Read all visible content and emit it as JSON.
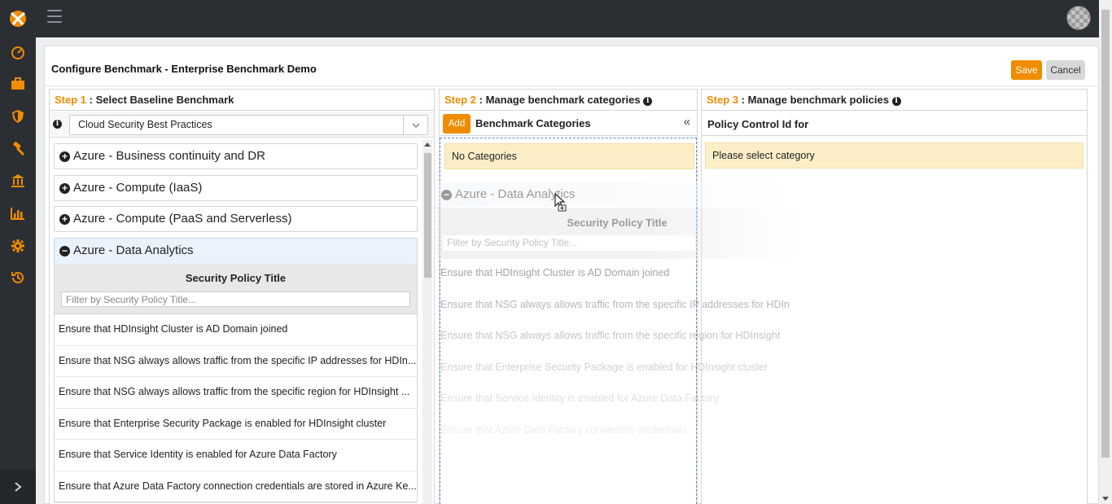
{
  "header": {
    "menu_icon": "hamburger-icon",
    "avatar_icon": "user-avatar"
  },
  "sidebar": {
    "items": [
      {
        "icon": "dashboard-gauge-icon"
      },
      {
        "icon": "briefcase-icon"
      },
      {
        "icon": "shield-icon"
      },
      {
        "icon": "hammer-icon"
      },
      {
        "icon": "bank-icon"
      },
      {
        "icon": "bar-chart-icon"
      },
      {
        "icon": "gear-icon"
      },
      {
        "icon": "history-icon"
      }
    ],
    "expand_icon": "chevron-right-icon"
  },
  "page": {
    "title": "Configure Benchmark - Enterprise Benchmark Demo",
    "save_label": "Save",
    "cancel_label": "Cancel"
  },
  "step1": {
    "step_label": "Step 1",
    "title": " : Select Baseline Benchmark",
    "selected_benchmark": "Cloud Security Best Practices",
    "categories": [
      {
        "label": "Azure - Business continuity and DR",
        "expanded": false
      },
      {
        "label": "Azure - Compute (IaaS)",
        "expanded": false
      },
      {
        "label": "Azure - Compute (PaaS and Serverless)",
        "expanded": false
      },
      {
        "label": "Azure - Data Analytics",
        "expanded": true
      }
    ],
    "policy_table": {
      "header": "Security Policy Title",
      "filter_placeholder": "Filter by Security Policy Title...",
      "rows": [
        "Ensure that HDInsight Cluster is AD Domain joined",
        "Ensure that NSG always allows traffic from the specific IP addresses for HDIn...",
        "Ensure that NSG always allows traffic from the specific region for HDInsight ...",
        "Ensure that Enterprise Security Package is enabled for HDInsight cluster",
        "Ensure that Service Identity is enabled for Azure Data Factory",
        "Ensure that Azure Data Factory connection credentials are stored in Azure Ke..."
      ]
    }
  },
  "step2": {
    "step_label": "Step 2",
    "title": " : Manage benchmark categories ",
    "add_label": "Add",
    "subtitle": "Benchmark Categories",
    "collapse_glyph": "«",
    "empty_text": "No Categories",
    "drag_ghost": {
      "label": "Azure - Data Analytics",
      "header": "Security Policy Title",
      "filter_placeholder": "Filter by Security Policy Title...",
      "rows": [
        "Ensure that HDInsight Cluster is AD Domain joined",
        "Ensure that NSG always allows traffic from the specific IP addresses for HDIn",
        "Ensure that NSG always allows traffic from the specific region for HDInsight",
        "Ensure that Enterprise Security Package is enabled for HDInsight cluster",
        "Ensure that Service Identity is enabled for Azure Data Factory",
        "Ensure that Azure Data Factory connection credentials"
      ]
    }
  },
  "step3": {
    "step_label": "Step 3",
    "title": " : Manage benchmark policies ",
    "subtitle": "Policy Control Id for",
    "empty_text": "Please select category"
  },
  "colors": {
    "accent": "#f08c00",
    "topbar": "#2b2f33",
    "notice_bg": "#fcefc7"
  }
}
